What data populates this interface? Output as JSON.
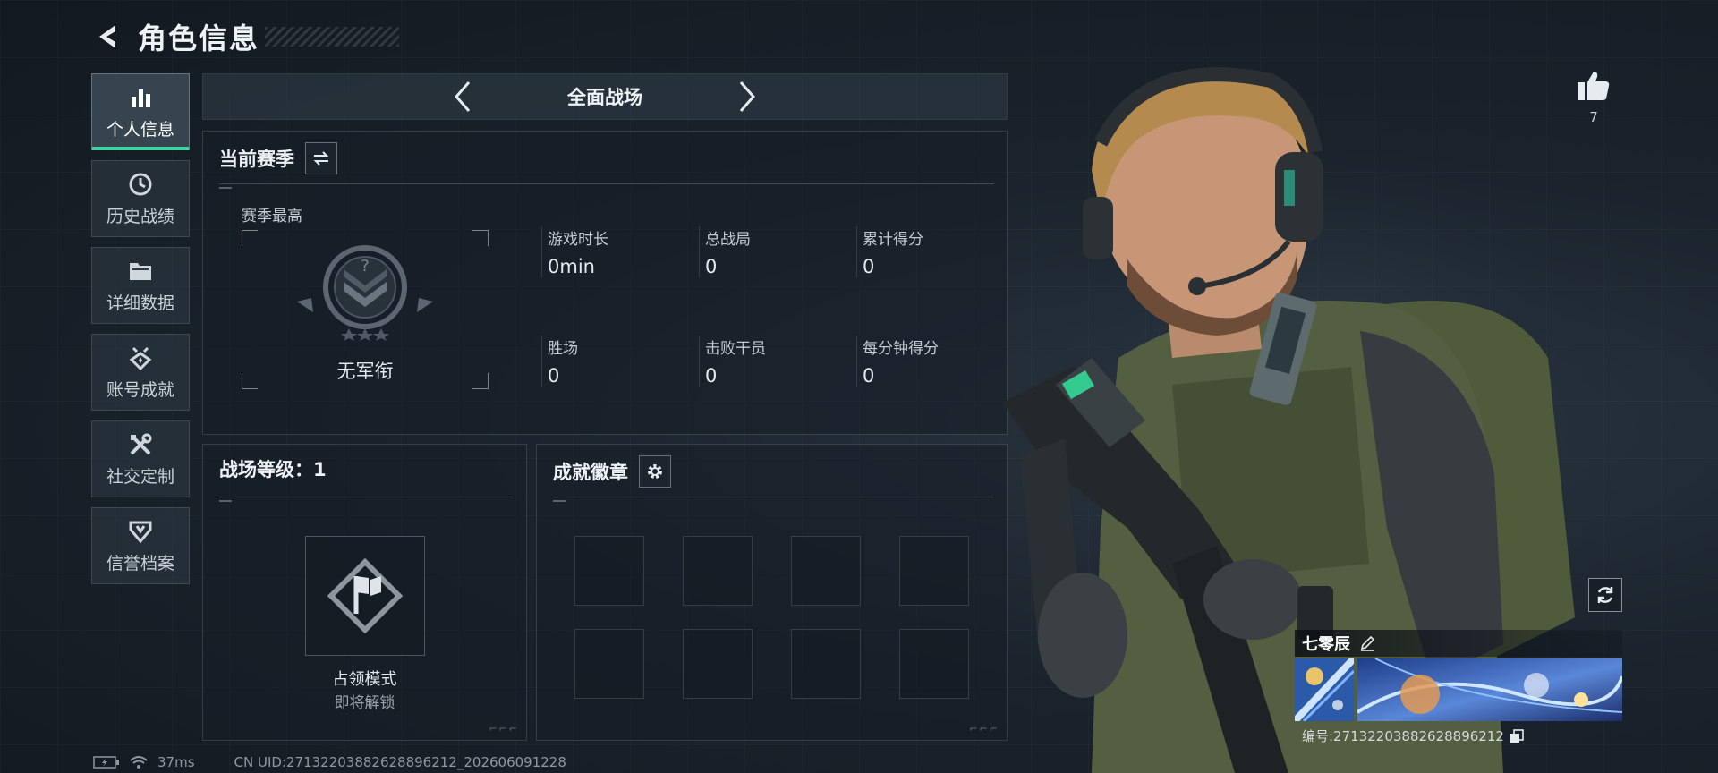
{
  "header": {
    "title": "角色信息"
  },
  "nav": {
    "items": [
      {
        "label": "个人信息",
        "icon": "bar-chart-icon",
        "active": true
      },
      {
        "label": "历史战绩",
        "icon": "clock-icon"
      },
      {
        "label": "详细数据",
        "icon": "folder-icon"
      },
      {
        "label": "账号成就",
        "icon": "star-badge-icon"
      },
      {
        "label": "社交定制",
        "icon": "tools-icon"
      },
      {
        "label": "信誉档案",
        "icon": "shield-icon"
      }
    ]
  },
  "mode_bar": {
    "title": "全面战场"
  },
  "season": {
    "title": "当前赛季",
    "rank_label": "赛季最高",
    "rank_name": "无军衔",
    "stats": [
      {
        "label": "游戏时长",
        "value": "0min"
      },
      {
        "label": "总战局",
        "value": "0"
      },
      {
        "label": "累计得分",
        "value": "0"
      },
      {
        "label": "胜场",
        "value": "0"
      },
      {
        "label": "击败干员",
        "value": "0"
      },
      {
        "label": "每分钟得分",
        "value": "0"
      }
    ]
  },
  "level": {
    "title": "战场等级：1",
    "mode_name": "占领模式",
    "mode_status": "即将解锁"
  },
  "badges": {
    "title": "成就徽章"
  },
  "footer": {
    "ping": "37ms",
    "uid_line": "CN UID:271322038826288962​12_202606091228"
  },
  "like": {
    "count": "7"
  },
  "player": {
    "name": "七零辰",
    "id_line": "编号:2713220388262889621​2"
  },
  "colors": {
    "accent": "#3fd3a8",
    "background": "#141b22",
    "panel": "#1c2630"
  }
}
